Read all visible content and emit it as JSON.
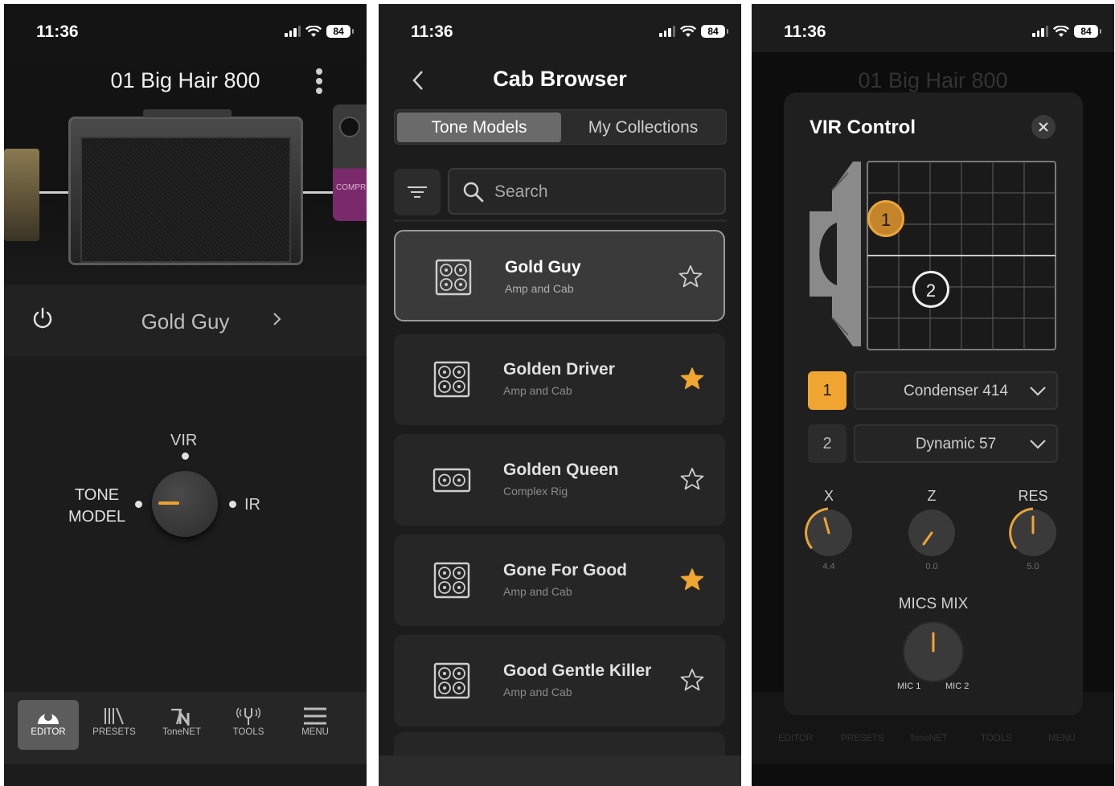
{
  "status": {
    "time": "11:36",
    "battery": "84"
  },
  "editor": {
    "preset_title": "01 Big Hair 800",
    "pedal_text": "COMPR",
    "model_name": "Gold Guy",
    "selector": {
      "top": "VIR",
      "left_line1": "TONE",
      "left_line2": "MODEL",
      "right": "IR"
    },
    "tabs": [
      {
        "label": "EDITOR",
        "icon": "amp-knob-icon"
      },
      {
        "label": "PRESETS",
        "icon": "library-icon"
      },
      {
        "label": "ToneNET",
        "icon": "tonenet-icon"
      },
      {
        "label": "TOOLS",
        "icon": "tuning-fork-icon"
      },
      {
        "label": "MENU",
        "icon": "hamburger-icon"
      }
    ]
  },
  "browser": {
    "title": "Cab Browser",
    "segments": [
      "Tone Models",
      "My Collections"
    ],
    "search_placeholder": "Search",
    "items": [
      {
        "name": "Gold Guy",
        "sub": "Amp and Cab",
        "favorite": false,
        "cab": "4x12"
      },
      {
        "name": "Golden Driver",
        "sub": "Amp and Cab",
        "favorite": true,
        "cab": "4x12"
      },
      {
        "name": "Golden Queen",
        "sub": "Complex Rig",
        "favorite": false,
        "cab": "2x12"
      },
      {
        "name": "Gone For Good",
        "sub": "Amp and Cab",
        "favorite": true,
        "cab": "4x12"
      },
      {
        "name": "Good Gentle Killer",
        "sub": "Amp and Cab",
        "favorite": false,
        "cab": "4x12"
      }
    ]
  },
  "vir": {
    "background_title": "01 Big Hair 800",
    "title": "VIR Control",
    "mic_positions": [
      "1",
      "2"
    ],
    "mics": [
      {
        "num": "1",
        "model": "Condenser 414"
      },
      {
        "num": "2",
        "model": "Dynamic 57"
      }
    ],
    "knobs": [
      {
        "label": "X",
        "value": "4.4"
      },
      {
        "label": "Z",
        "value": "0.0"
      },
      {
        "label": "RES",
        "value": "5.0"
      }
    ],
    "mics_mix": {
      "label": "MICS MIX",
      "left": "MIC 1",
      "right": "MIC 2"
    },
    "ghost_tabs": [
      "EDITOR",
      "PRESETS",
      "ToneNET",
      "TOOLS",
      "MENU"
    ]
  },
  "colors": {
    "accent": "#f0a530",
    "background": "#1c1c1c",
    "card": "#262626"
  }
}
